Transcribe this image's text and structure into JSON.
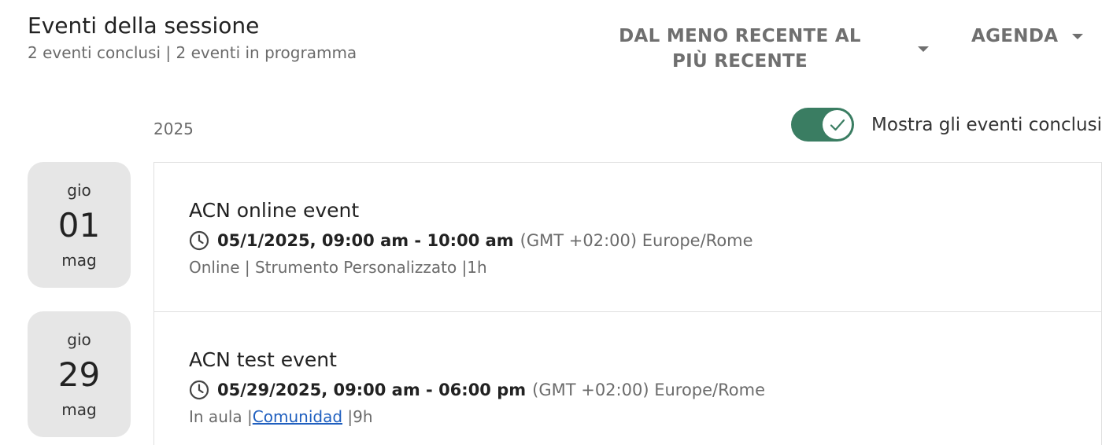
{
  "header": {
    "title": "Eventi della sessione",
    "subtitle": "2 eventi conclusi | 2 eventi in programma"
  },
  "controls": {
    "sort_label": "DAL MENO RECENTE AL PIÙ RECENTE",
    "view_label": "AGENDA",
    "toggle_label": "Mostra gli eventi conclusi",
    "toggle_on": true
  },
  "year": "2025",
  "events": [
    {
      "dow": "gio",
      "day": "01",
      "month": "mag",
      "title": "ACN online event",
      "time_range": "05/1/2025, 09:00 am - 10:00 am",
      "timezone": "(GMT +02:00) Europe/Rome",
      "meta_prefix": "Online | Strumento Personalizzato |1h",
      "meta_link": "",
      "meta_suffix": ""
    },
    {
      "dow": "gio",
      "day": "29",
      "month": "mag",
      "title": "ACN test event",
      "time_range": "05/29/2025, 09:00 am - 06:00 pm",
      "timezone": "(GMT +02:00) Europe/Rome",
      "meta_prefix": "In aula |",
      "meta_link": "Comunidad",
      "meta_suffix": " |9h"
    }
  ],
  "colors": {
    "toggle_accent": "#3a7d62",
    "link": "#1f5fbf",
    "date_badge_bg": "#e6e6e6"
  },
  "icons": {
    "clock": "clock-icon",
    "check": "check-icon",
    "caret": "chevron-down-icon"
  }
}
